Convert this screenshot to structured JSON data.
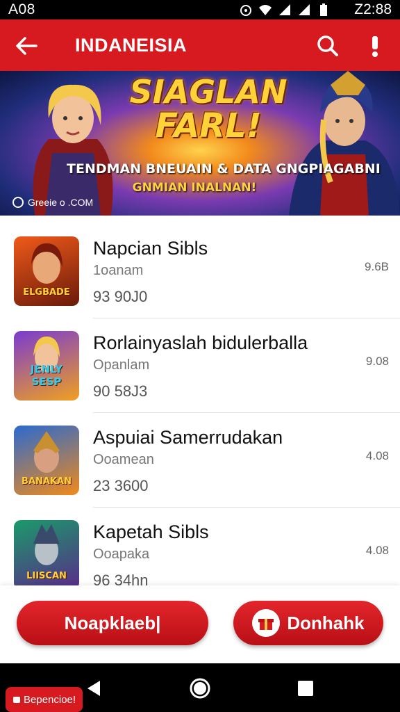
{
  "status_bar": {
    "left_text": "A08",
    "time": "Z2:88"
  },
  "app_bar": {
    "title": "INDANEISIA"
  },
  "banner": {
    "title_line1": "SIAGLAN",
    "title_line2": "FARL!",
    "subtitle": "TENDMAN BNEUAIN & DATA GNGPIAGABNI",
    "subtitle2": "GNMIAN INALNAN!",
    "credit": "Greeie o      .COM"
  },
  "games": [
    {
      "name": "Napcian Sibls",
      "developer": "1oanam",
      "downloads": "93 90J0",
      "rating": "9.6B",
      "icon_label": "ELGBADE",
      "icon_colors": [
        "#f05a1a",
        "#6a1a0a"
      ]
    },
    {
      "name": "Rorlainyaslah bidulerballa",
      "developer": "Opanlam",
      "downloads": "90 58J3",
      "rating": "9.08",
      "icon_label": "JENLY SESP",
      "icon_colors": [
        "#7a3bd0",
        "#f0a020"
      ]
    },
    {
      "name": "Aspuiai Samerrudakan",
      "developer": "Ooamean",
      "downloads": "23 3600",
      "rating": "4.08",
      "icon_label": "BANAKAN",
      "icon_colors": [
        "#2a6ad0",
        "#f08a1a"
      ]
    },
    {
      "name": "Kapetah Sibls",
      "developer": "Ooapaka",
      "downloads": "96 34hn",
      "rating": "4.08",
      "icon_label": "LIISCAN",
      "icon_colors": [
        "#1a9a6a",
        "#5a2a8a"
      ]
    }
  ],
  "actions": {
    "primary_label": "Noapklaeb|",
    "secondary_label": "Donhahk"
  },
  "nav": {
    "badge_label": "Bepencioe!"
  },
  "colors": {
    "brand_red": "#d71920"
  }
}
